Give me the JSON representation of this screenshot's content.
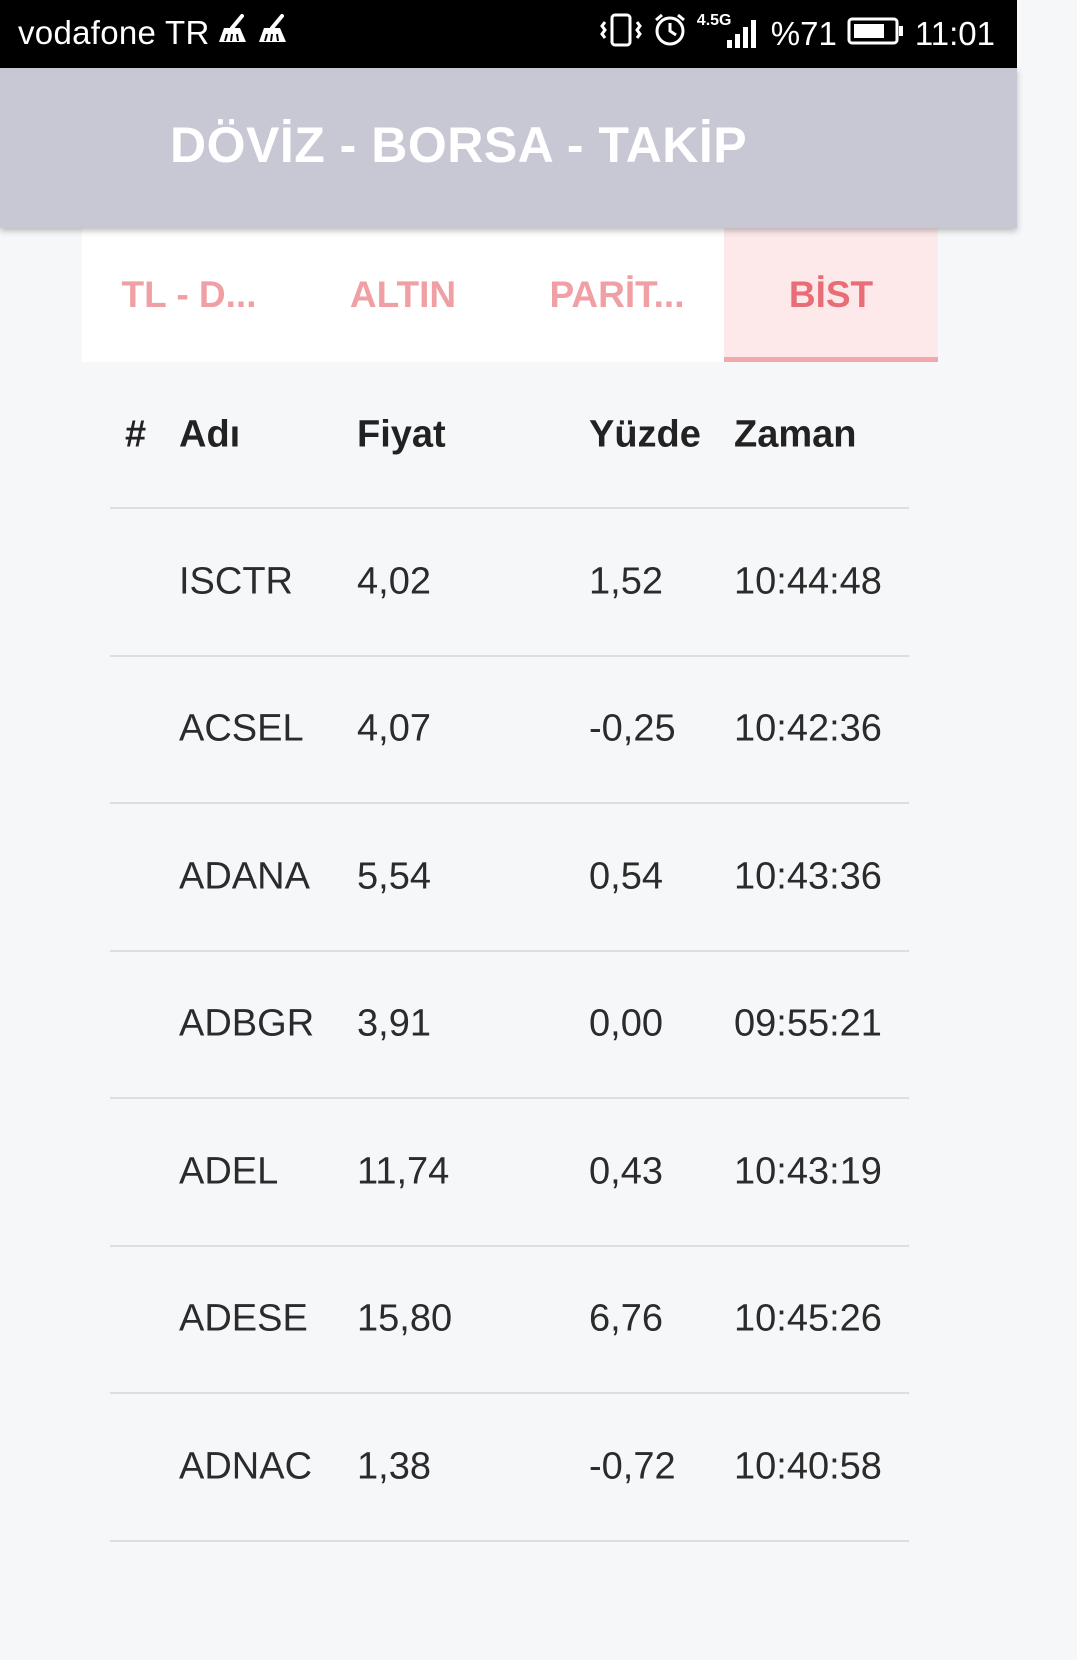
{
  "status_bar": {
    "carrier": "vodafone TR",
    "network": "4.5G",
    "battery": "%71",
    "time": "11:01"
  },
  "app_bar": {
    "title": "DÖVİZ - BORSA - TAKİP"
  },
  "tabs": [
    {
      "label": "TL - D...",
      "active": false
    },
    {
      "label": "ALTIN",
      "active": false
    },
    {
      "label": "PARİT...",
      "active": false
    },
    {
      "label": "BİST",
      "active": true
    }
  ],
  "table": {
    "headers": {
      "num": "#",
      "name": "Adı",
      "price": "Fiyat",
      "pct": "Yüzde",
      "time": "Zaman"
    },
    "rows": [
      {
        "num": "",
        "name": "ISCTR",
        "price": "4,02",
        "pct": "1,52",
        "time": "10:44:48"
      },
      {
        "num": "",
        "name": "ACSEL",
        "price": "4,07",
        "pct": "-0,25",
        "time": "10:42:36"
      },
      {
        "num": "",
        "name": "ADANA",
        "price": "5,54",
        "pct": "0,54",
        "time": "10:43:36"
      },
      {
        "num": "",
        "name": "ADBGR",
        "price": "3,91",
        "pct": "0,00",
        "time": "09:55:21"
      },
      {
        "num": "",
        "name": "ADEL",
        "price": "11,74",
        "pct": "0,43",
        "time": "10:43:19"
      },
      {
        "num": "",
        "name": "ADESE",
        "price": "15,80",
        "pct": "6,76",
        "time": "10:45:26"
      },
      {
        "num": "",
        "name": "ADNAC",
        "price": "1,38",
        "pct": "-0,72",
        "time": "10:40:58"
      }
    ]
  },
  "colors": {
    "app_bar": "#c8c8d4",
    "tab_text": "#f0a0a4",
    "tab_active_text": "#e86d76",
    "tab_active_bg": "#fde9ea"
  }
}
